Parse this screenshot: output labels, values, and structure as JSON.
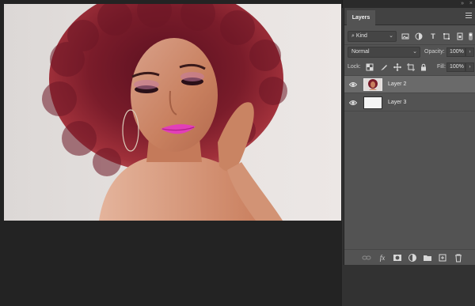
{
  "panel": {
    "tab_label": "Layers",
    "collapse_glyph": "»",
    "close_glyph": "×",
    "filter": {
      "value": "Kind",
      "chevron": "⌄"
    },
    "blend_mode": {
      "value": "Normal",
      "chevron": "⌄"
    },
    "opacity": {
      "label": "Opacity:",
      "value": "100%",
      "stepper": "›"
    },
    "lock": {
      "label": "Lock:"
    },
    "fill": {
      "label": "Fill:",
      "value": "100%",
      "stepper": "›"
    },
    "filter_icons": [
      "image-filter-icon",
      "adjustment-filter-icon",
      "type-filter-icon",
      "shape-filter-icon",
      "smart-object-filter-icon"
    ],
    "lock_icons": [
      "lock-transparent-pixels-icon",
      "lock-image-pixels-icon",
      "lock-position-icon",
      "lock-artboard-icon",
      "lock-all-icon"
    ],
    "layers": [
      {
        "name": "Layer 2",
        "selected": true,
        "visible": true
      },
      {
        "name": "Layer 3",
        "selected": false,
        "visible": true
      }
    ],
    "footer_icons": [
      "link-layers-icon",
      "layer-style-icon",
      "add-mask-icon",
      "adjustment-layer-icon",
      "new-group-icon",
      "new-layer-icon",
      "delete-layer-icon"
    ],
    "glyphs": {
      "filter_type": "T",
      "layer_style": "fx"
    }
  },
  "colors": {
    "selected_row": "#6a6a6a",
    "panel_bg": "#535353",
    "app_bg": "#232323"
  }
}
